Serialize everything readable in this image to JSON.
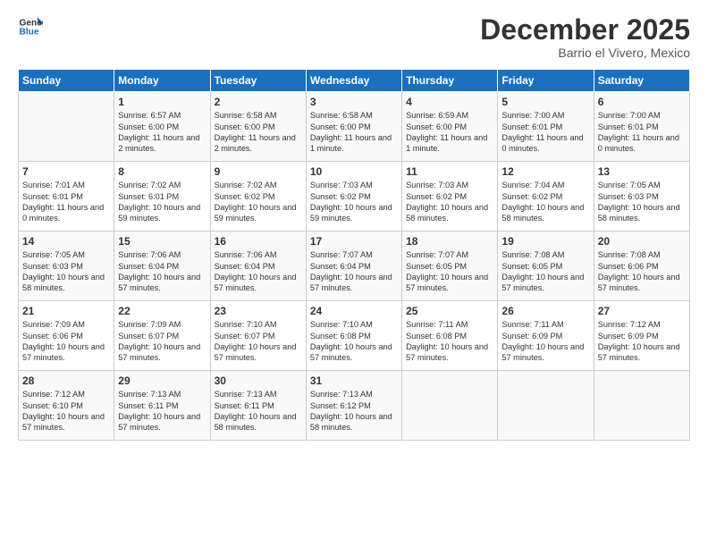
{
  "logo": {
    "line1": "General",
    "line2": "Blue"
  },
  "title": "December 2025",
  "subtitle": "Barrio el Vivero, Mexico",
  "days_header": [
    "Sunday",
    "Monday",
    "Tuesday",
    "Wednesday",
    "Thursday",
    "Friday",
    "Saturday"
  ],
  "weeks": [
    [
      {
        "num": "",
        "sunrise": "",
        "sunset": "",
        "daylight": ""
      },
      {
        "num": "1",
        "sunrise": "Sunrise: 6:57 AM",
        "sunset": "Sunset: 6:00 PM",
        "daylight": "Daylight: 11 hours and 2 minutes."
      },
      {
        "num": "2",
        "sunrise": "Sunrise: 6:58 AM",
        "sunset": "Sunset: 6:00 PM",
        "daylight": "Daylight: 11 hours and 2 minutes."
      },
      {
        "num": "3",
        "sunrise": "Sunrise: 6:58 AM",
        "sunset": "Sunset: 6:00 PM",
        "daylight": "Daylight: 11 hours and 1 minute."
      },
      {
        "num": "4",
        "sunrise": "Sunrise: 6:59 AM",
        "sunset": "Sunset: 6:00 PM",
        "daylight": "Daylight: 11 hours and 1 minute."
      },
      {
        "num": "5",
        "sunrise": "Sunrise: 7:00 AM",
        "sunset": "Sunset: 6:01 PM",
        "daylight": "Daylight: 11 hours and 0 minutes."
      },
      {
        "num": "6",
        "sunrise": "Sunrise: 7:00 AM",
        "sunset": "Sunset: 6:01 PM",
        "daylight": "Daylight: 11 hours and 0 minutes."
      }
    ],
    [
      {
        "num": "7",
        "sunrise": "Sunrise: 7:01 AM",
        "sunset": "Sunset: 6:01 PM",
        "daylight": "Daylight: 11 hours and 0 minutes."
      },
      {
        "num": "8",
        "sunrise": "Sunrise: 7:02 AM",
        "sunset": "Sunset: 6:01 PM",
        "daylight": "Daylight: 10 hours and 59 minutes."
      },
      {
        "num": "9",
        "sunrise": "Sunrise: 7:02 AM",
        "sunset": "Sunset: 6:02 PM",
        "daylight": "Daylight: 10 hours and 59 minutes."
      },
      {
        "num": "10",
        "sunrise": "Sunrise: 7:03 AM",
        "sunset": "Sunset: 6:02 PM",
        "daylight": "Daylight: 10 hours and 59 minutes."
      },
      {
        "num": "11",
        "sunrise": "Sunrise: 7:03 AM",
        "sunset": "Sunset: 6:02 PM",
        "daylight": "Daylight: 10 hours and 58 minutes."
      },
      {
        "num": "12",
        "sunrise": "Sunrise: 7:04 AM",
        "sunset": "Sunset: 6:02 PM",
        "daylight": "Daylight: 10 hours and 58 minutes."
      },
      {
        "num": "13",
        "sunrise": "Sunrise: 7:05 AM",
        "sunset": "Sunset: 6:03 PM",
        "daylight": "Daylight: 10 hours and 58 minutes."
      }
    ],
    [
      {
        "num": "14",
        "sunrise": "Sunrise: 7:05 AM",
        "sunset": "Sunset: 6:03 PM",
        "daylight": "Daylight: 10 hours and 58 minutes."
      },
      {
        "num": "15",
        "sunrise": "Sunrise: 7:06 AM",
        "sunset": "Sunset: 6:04 PM",
        "daylight": "Daylight: 10 hours and 57 minutes."
      },
      {
        "num": "16",
        "sunrise": "Sunrise: 7:06 AM",
        "sunset": "Sunset: 6:04 PM",
        "daylight": "Daylight: 10 hours and 57 minutes."
      },
      {
        "num": "17",
        "sunrise": "Sunrise: 7:07 AM",
        "sunset": "Sunset: 6:04 PM",
        "daylight": "Daylight: 10 hours and 57 minutes."
      },
      {
        "num": "18",
        "sunrise": "Sunrise: 7:07 AM",
        "sunset": "Sunset: 6:05 PM",
        "daylight": "Daylight: 10 hours and 57 minutes."
      },
      {
        "num": "19",
        "sunrise": "Sunrise: 7:08 AM",
        "sunset": "Sunset: 6:05 PM",
        "daylight": "Daylight: 10 hours and 57 minutes."
      },
      {
        "num": "20",
        "sunrise": "Sunrise: 7:08 AM",
        "sunset": "Sunset: 6:06 PM",
        "daylight": "Daylight: 10 hours and 57 minutes."
      }
    ],
    [
      {
        "num": "21",
        "sunrise": "Sunrise: 7:09 AM",
        "sunset": "Sunset: 6:06 PM",
        "daylight": "Daylight: 10 hours and 57 minutes."
      },
      {
        "num": "22",
        "sunrise": "Sunrise: 7:09 AM",
        "sunset": "Sunset: 6:07 PM",
        "daylight": "Daylight: 10 hours and 57 minutes."
      },
      {
        "num": "23",
        "sunrise": "Sunrise: 7:10 AM",
        "sunset": "Sunset: 6:07 PM",
        "daylight": "Daylight: 10 hours and 57 minutes."
      },
      {
        "num": "24",
        "sunrise": "Sunrise: 7:10 AM",
        "sunset": "Sunset: 6:08 PM",
        "daylight": "Daylight: 10 hours and 57 minutes."
      },
      {
        "num": "25",
        "sunrise": "Sunrise: 7:11 AM",
        "sunset": "Sunset: 6:08 PM",
        "daylight": "Daylight: 10 hours and 57 minutes."
      },
      {
        "num": "26",
        "sunrise": "Sunrise: 7:11 AM",
        "sunset": "Sunset: 6:09 PM",
        "daylight": "Daylight: 10 hours and 57 minutes."
      },
      {
        "num": "27",
        "sunrise": "Sunrise: 7:12 AM",
        "sunset": "Sunset: 6:09 PM",
        "daylight": "Daylight: 10 hours and 57 minutes."
      }
    ],
    [
      {
        "num": "28",
        "sunrise": "Sunrise: 7:12 AM",
        "sunset": "Sunset: 6:10 PM",
        "daylight": "Daylight: 10 hours and 57 minutes."
      },
      {
        "num": "29",
        "sunrise": "Sunrise: 7:13 AM",
        "sunset": "Sunset: 6:11 PM",
        "daylight": "Daylight: 10 hours and 57 minutes."
      },
      {
        "num": "30",
        "sunrise": "Sunrise: 7:13 AM",
        "sunset": "Sunset: 6:11 PM",
        "daylight": "Daylight: 10 hours and 58 minutes."
      },
      {
        "num": "31",
        "sunrise": "Sunrise: 7:13 AM",
        "sunset": "Sunset: 6:12 PM",
        "daylight": "Daylight: 10 hours and 58 minutes."
      },
      {
        "num": "",
        "sunrise": "",
        "sunset": "",
        "daylight": ""
      },
      {
        "num": "",
        "sunrise": "",
        "sunset": "",
        "daylight": ""
      },
      {
        "num": "",
        "sunrise": "",
        "sunset": "",
        "daylight": ""
      }
    ]
  ]
}
